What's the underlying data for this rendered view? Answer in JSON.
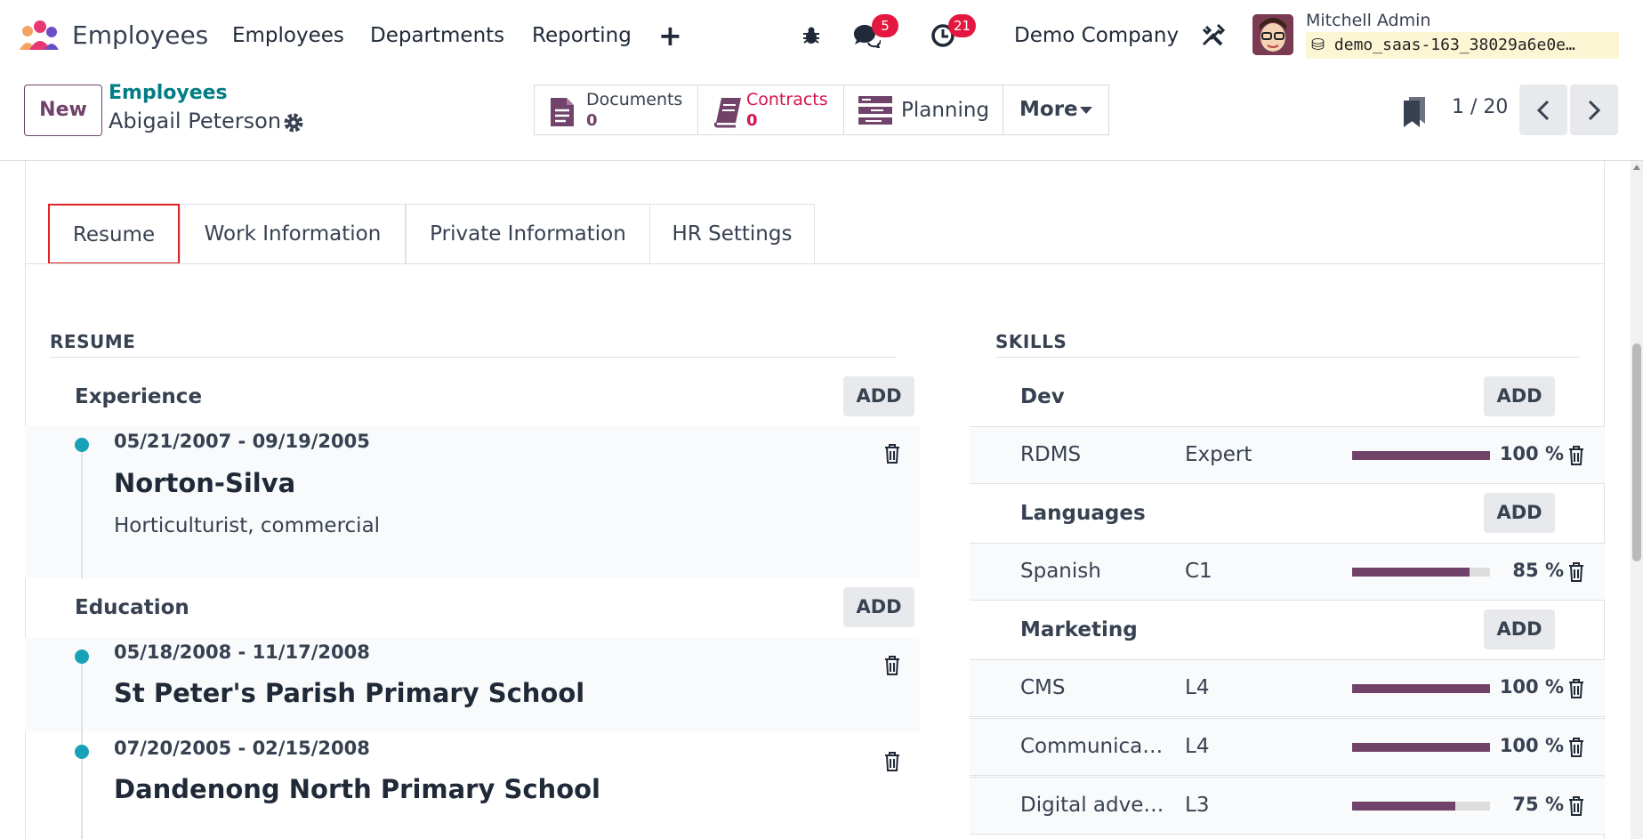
{
  "navbar": {
    "app_name": "Employees",
    "menu": [
      "Employees",
      "Departments",
      "Reporting"
    ],
    "plus": "+",
    "messages_count": "5",
    "activities_count": "21",
    "company": "Demo Company",
    "user_name": "Mitchell Admin",
    "database": "demo_saas-163_38029a6e0e…",
    "badge_color": "#e3173f"
  },
  "control_panel": {
    "new_label": "New",
    "breadcrumb_parent": "Employees",
    "breadcrumb_current": "Abigail Peterson",
    "smart_buttons": {
      "documents": {
        "label": "Documents",
        "value": "0"
      },
      "contracts": {
        "label": "Contracts",
        "value": "0"
      },
      "planning": {
        "label": "Planning"
      },
      "more": {
        "label": "More"
      }
    },
    "pager": "1 / 20"
  },
  "tabs": [
    "Resume",
    "Work Information",
    "Private Information",
    "HR Settings"
  ],
  "active_tab": "Resume",
  "resume": {
    "title": "RESUME",
    "add_label": "ADD",
    "experience": {
      "title": "Experience",
      "items": [
        {
          "dates": "05/21/2007 - 09/19/2005",
          "name": "Norton-Silva",
          "description": "Horticulturist, commercial"
        }
      ]
    },
    "education": {
      "title": "Education",
      "items": [
        {
          "dates": "05/18/2008 - 11/17/2008",
          "name": "St Peter's Parish Primary School"
        },
        {
          "dates": "07/20/2005 - 02/15/2008",
          "name": "Dandenong North Primary School"
        }
      ]
    }
  },
  "skills": {
    "title": "SKILLS",
    "add_label": "ADD",
    "groups": [
      {
        "title": "Dev",
        "items": [
          {
            "name": "RDMS",
            "level": "Expert",
            "progress": 100,
            "pct": "100 %"
          }
        ]
      },
      {
        "title": "Languages",
        "items": [
          {
            "name": "Spanish",
            "level": "C1",
            "progress": 85,
            "pct": "85 %"
          }
        ]
      },
      {
        "title": "Marketing",
        "items": [
          {
            "name": "CMS",
            "level": "L4",
            "progress": 100,
            "pct": "100 %"
          },
          {
            "name": "Communication",
            "level": "L4",
            "progress": 100,
            "pct": "100 %"
          },
          {
            "name": "Digital advertising",
            "level": "L3",
            "progress": 75,
            "pct": "75 %"
          }
        ]
      }
    ]
  },
  "colors": {
    "primary": "#71436a",
    "teal": "#017e84",
    "dot": "#17a2b8",
    "active_tab_border": "#e02424"
  }
}
